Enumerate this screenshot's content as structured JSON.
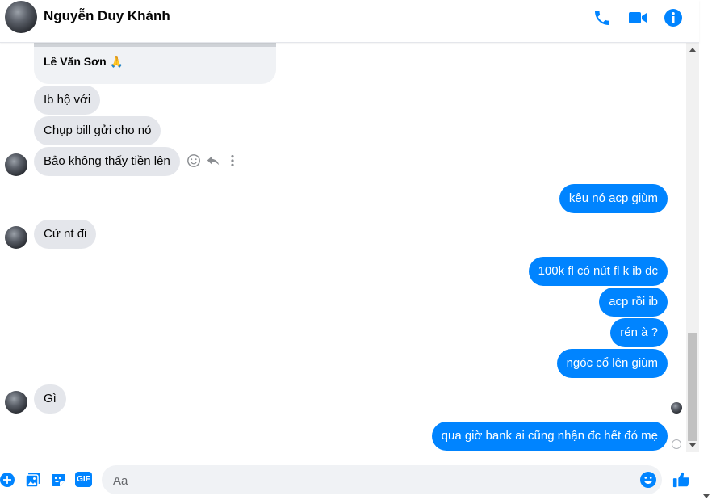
{
  "header": {
    "contact_name": "Nguyễn Duy Khánh",
    "icons": [
      "phone-icon",
      "video-camera-icon",
      "info-icon"
    ]
  },
  "thread": {
    "quoted_reply": "Lê Văn Sơn 🙏",
    "messages": [
      {
        "from": "them",
        "text": "Ib hộ với"
      },
      {
        "from": "them",
        "text": "Chụp bill gửi cho nó"
      },
      {
        "from": "them",
        "text": "Bảo không thấy tiền lên"
      },
      {
        "from": "me",
        "text": "kêu nó acp giùm"
      },
      {
        "from": "them",
        "text": "Cứ nt đi"
      },
      {
        "from": "me",
        "text": "100k fl có nút fl k ib đc"
      },
      {
        "from": "me",
        "text": "acp rồi ib"
      },
      {
        "from": "me",
        "text": "rén à ?"
      },
      {
        "from": "me",
        "text": "ngóc cổ lên giùm"
      },
      {
        "from": "them",
        "text": "Gì"
      },
      {
        "from": "me",
        "text": "qua giờ bank ai cũng nhận đc hết đó mẹ"
      }
    ],
    "hover_actions": [
      "emoji-react-icon",
      "reply-icon",
      "more-icon"
    ]
  },
  "composer": {
    "placeholder": "Aa",
    "gif_label": "GIF",
    "icons": [
      "plus-icon",
      "photo-icon",
      "sticker-icon",
      "gif-icon",
      "emoji-icon",
      "like-icon"
    ]
  },
  "colors": {
    "accent": "#0084ff",
    "incoming_bubble": "#e4e6eb",
    "input_bg": "#f0f2f5"
  }
}
